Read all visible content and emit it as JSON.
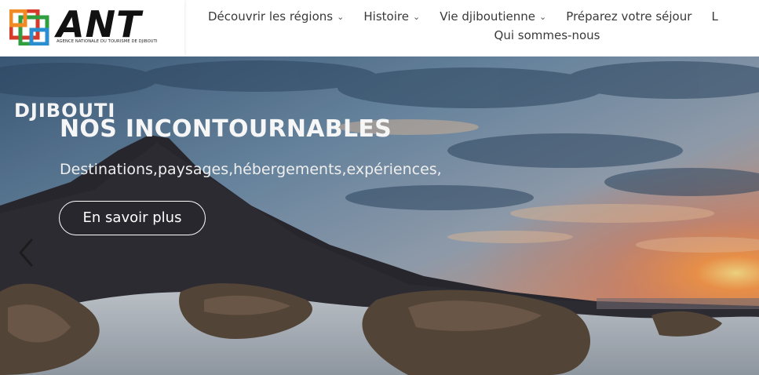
{
  "logo": {
    "wordmark": "ANT",
    "tagline": "AGENCE NATIONALE DU TOURISME DE DJIBOUTI"
  },
  "nav": {
    "items": [
      {
        "label": "Découvrir les régions",
        "has_dropdown": true
      },
      {
        "label": "Histoire",
        "has_dropdown": true
      },
      {
        "label": "Vie djiboutienne",
        "has_dropdown": true
      },
      {
        "label": "Préparez votre séjour",
        "has_dropdown": false
      },
      {
        "label": "L",
        "has_dropdown": false
      },
      {
        "label": "Qui sommes-nous",
        "has_dropdown": false
      }
    ]
  },
  "hero": {
    "tag": "DJIBOUTI",
    "title": "NOS INCONTOURNABLES",
    "subtitle": "Destinations,paysages,hébergements,expériences,",
    "cta_label": "En savoir plus",
    "prev_icon": "chevron-left-icon"
  },
  "colors": {
    "logo_green": "#2e9e3f",
    "logo_red": "#d63a2a",
    "logo_blue": "#2a8fd0",
    "logo_orange": "#f08a24",
    "nav_text": "#3a3a3a"
  }
}
